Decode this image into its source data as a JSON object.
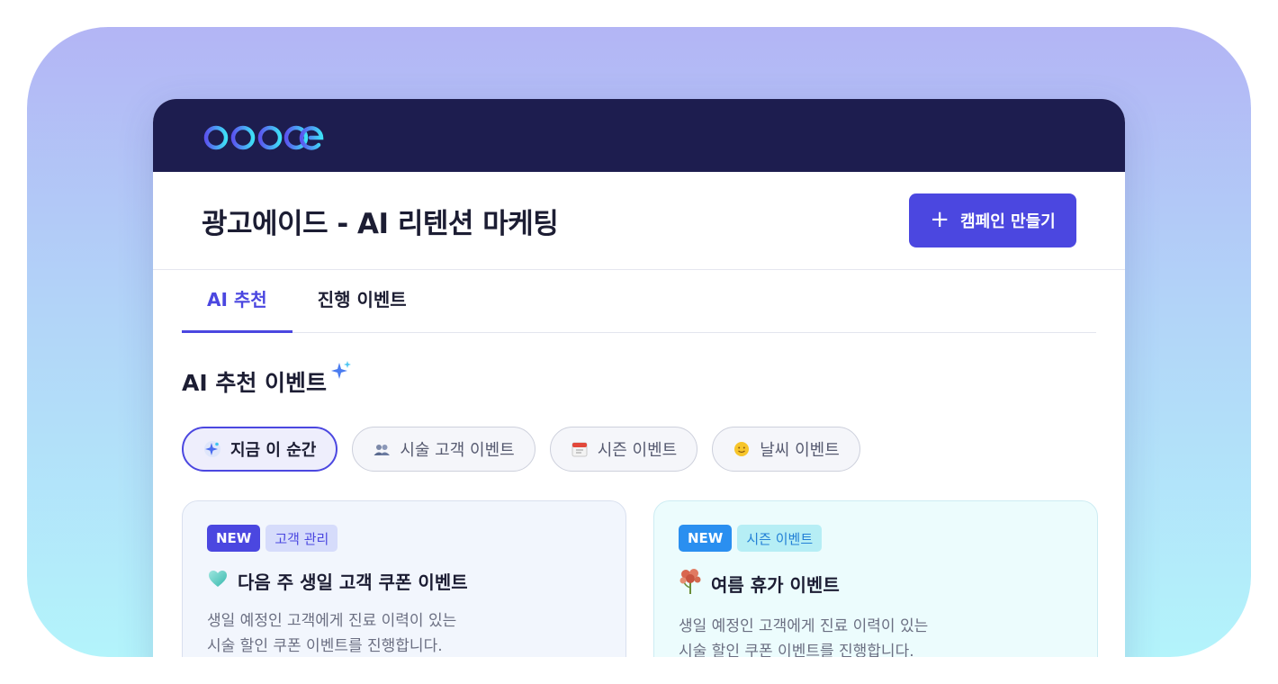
{
  "header": {
    "title": "광고에이드 - AI 리텐션 마케팅",
    "create_button": "캠페인 만들기"
  },
  "tabs": [
    {
      "label": "AI 추천",
      "active": true
    },
    {
      "label": "진행 이벤트",
      "active": false
    }
  ],
  "section": {
    "title": "AI 추천 이벤트"
  },
  "filters": [
    {
      "label": "지금 이 순간",
      "icon": "sparkle-icon",
      "active": true
    },
    {
      "label": "시술 고객 이벤트",
      "icon": "people-icon",
      "active": false
    },
    {
      "label": "시즌 이벤트",
      "icon": "calendar-icon",
      "active": false
    },
    {
      "label": "날씨 이벤트",
      "icon": "sun-icon",
      "active": false
    }
  ],
  "cards": [
    {
      "badge": "NEW",
      "category": "고객 관리",
      "icon": "heart-icon",
      "title": "다음 주 생일 고객 쿠폰 이벤트",
      "desc_line1": "생일 예정인 고객에게 진료 이력이 있는",
      "desc_line2": "시술 할인 쿠폰 이벤트를 진행합니다."
    },
    {
      "badge": "NEW",
      "category": "시즌 이벤트",
      "icon": "flower-icon",
      "title": "여름 휴가 이벤트",
      "desc_line1": "생일 예정인 고객에게 진료 이력이 있는",
      "desc_line2": "시술 할인 쿠폰 이벤트를 진행합니다."
    }
  ],
  "colors": {
    "accent": "#4b47e0",
    "topbar": "#1d1d4f",
    "badge_blue": "#2a8ff0"
  }
}
